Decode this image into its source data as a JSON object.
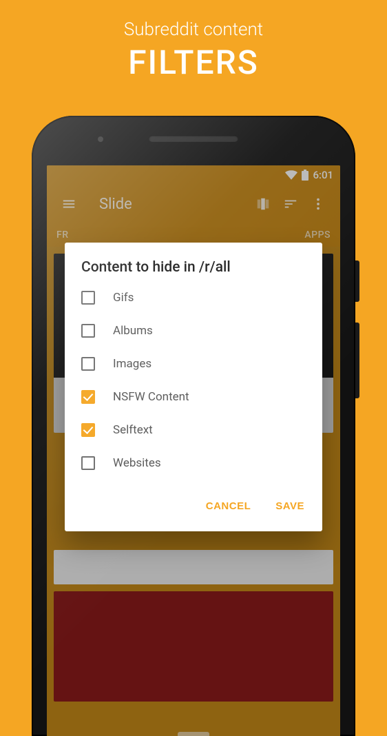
{
  "promo": {
    "subtitle": "Subreddit content",
    "title": "FILTERS"
  },
  "status": {
    "time": "6:01"
  },
  "appbar": {
    "title": "Slide"
  },
  "tabs": {
    "left": "FR",
    "right": "APPS"
  },
  "dialog": {
    "title": "Content to hide in /r/all",
    "options": [
      {
        "label": "Gifs",
        "checked": false
      },
      {
        "label": "Albums",
        "checked": false
      },
      {
        "label": "Images",
        "checked": false
      },
      {
        "label": "NSFW Content",
        "checked": true
      },
      {
        "label": "Selftext",
        "checked": true
      },
      {
        "label": "Websites",
        "checked": false
      }
    ],
    "cancel": "CANCEL",
    "save": "SAVE"
  }
}
